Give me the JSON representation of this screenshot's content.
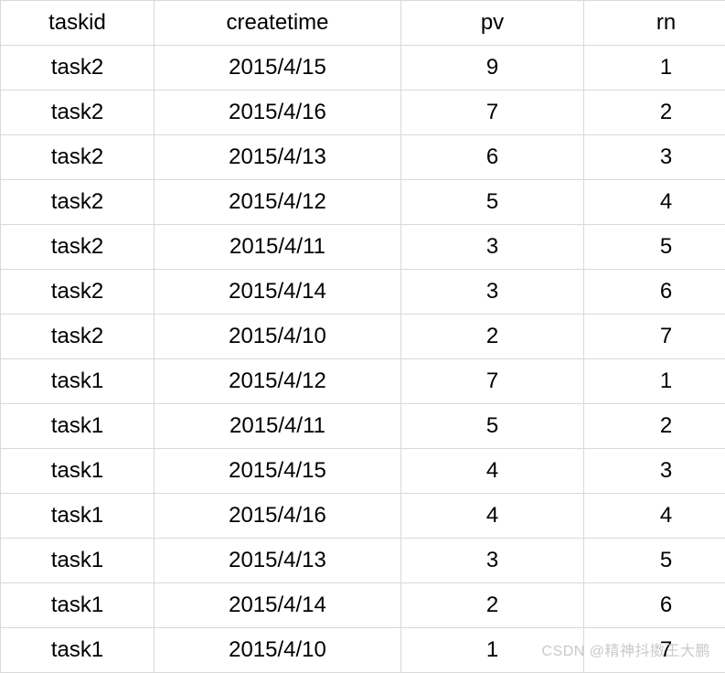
{
  "chart_data": {
    "type": "table",
    "columns": [
      "taskid",
      "createtime",
      "pv",
      "rn"
    ],
    "rows": [
      {
        "taskid": "task2",
        "createtime": "2015/4/15",
        "pv": 9,
        "rn": 1
      },
      {
        "taskid": "task2",
        "createtime": "2015/4/16",
        "pv": 7,
        "rn": 2
      },
      {
        "taskid": "task2",
        "createtime": "2015/4/13",
        "pv": 6,
        "rn": 3
      },
      {
        "taskid": "task2",
        "createtime": "2015/4/12",
        "pv": 5,
        "rn": 4
      },
      {
        "taskid": "task2",
        "createtime": "2015/4/11",
        "pv": 3,
        "rn": 5
      },
      {
        "taskid": "task2",
        "createtime": "2015/4/14",
        "pv": 3,
        "rn": 6
      },
      {
        "taskid": "task2",
        "createtime": "2015/4/10",
        "pv": 2,
        "rn": 7
      },
      {
        "taskid": "task1",
        "createtime": "2015/4/12",
        "pv": 7,
        "rn": 1
      },
      {
        "taskid": "task1",
        "createtime": "2015/4/11",
        "pv": 5,
        "rn": 2
      },
      {
        "taskid": "task1",
        "createtime": "2015/4/15",
        "pv": 4,
        "rn": 3
      },
      {
        "taskid": "task1",
        "createtime": "2015/4/16",
        "pv": 4,
        "rn": 4
      },
      {
        "taskid": "task1",
        "createtime": "2015/4/13",
        "pv": 3,
        "rn": 5
      },
      {
        "taskid": "task1",
        "createtime": "2015/4/14",
        "pv": 2,
        "rn": 6
      },
      {
        "taskid": "task1",
        "createtime": "2015/4/10",
        "pv": 1,
        "rn": 7
      }
    ]
  },
  "watermark": "CSDN @精神抖擞王大鹏"
}
